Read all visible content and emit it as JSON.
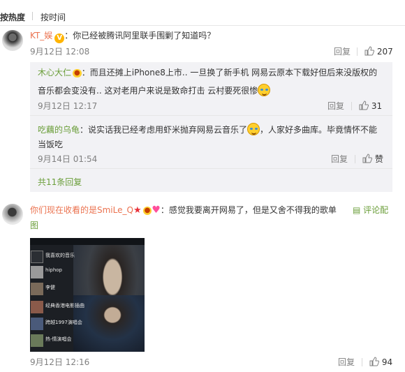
{
  "tabs": {
    "hot": "按热度",
    "time": "按时间"
  },
  "comments": [
    {
      "user": "KT_娱",
      "text": "：你已经被腾讯阿里联手围剿了知道吗？",
      "time": "9月12日 12:08",
      "reply": "回复",
      "likes": "207",
      "replies": [
        {
          "user": "木心大仁",
          "text1": "：而且还摊上iPhone8上市.. 一旦换了新手机 网易云原本下载好但后来没版权的",
          "text2": "音乐都会变没有.. 这对老用户来说是致命打击 云村要死很惨",
          "time": "9月12日 12:17",
          "reply": "回复",
          "likes": "31"
        },
        {
          "user": "吃藕的乌龟",
          "text1": "：说实话我已经考虑用虾米抛弃网易云音乐了",
          "text1b": "，人家好多曲库。毕竟情怀不能",
          "text2": "当饭吃",
          "time": "9月14日 01:54",
          "reply": "回复",
          "likes": "赞"
        }
      ],
      "more": "共11条回复"
    },
    {
      "user": "你们现在收看的是SmiLe_Q",
      "text": "：感觉我要离开网易了，但是又舍不得我的歌单",
      "pic_link_1": "评论配",
      "pic_link_2": "图",
      "time": "9月12日 12:16",
      "reply": "回复",
      "likes": "94",
      "image_rows": [
        "我喜欢的音乐",
        "hiphop",
        "李健",
        "经典香港电影插曲",
        "跨越1997演唱会",
        "热-情演唱会"
      ]
    }
  ],
  "colors": {
    "name_orange": "#eb7350",
    "name_green": "#6b9e3a",
    "subbox": "#f2f2f5"
  },
  "icons": [
    "thumb-up-icon",
    "v-badge-icon",
    "laugh-cry-emoji-icon",
    "star-icon",
    "heart-icon",
    "picture-icon"
  ]
}
